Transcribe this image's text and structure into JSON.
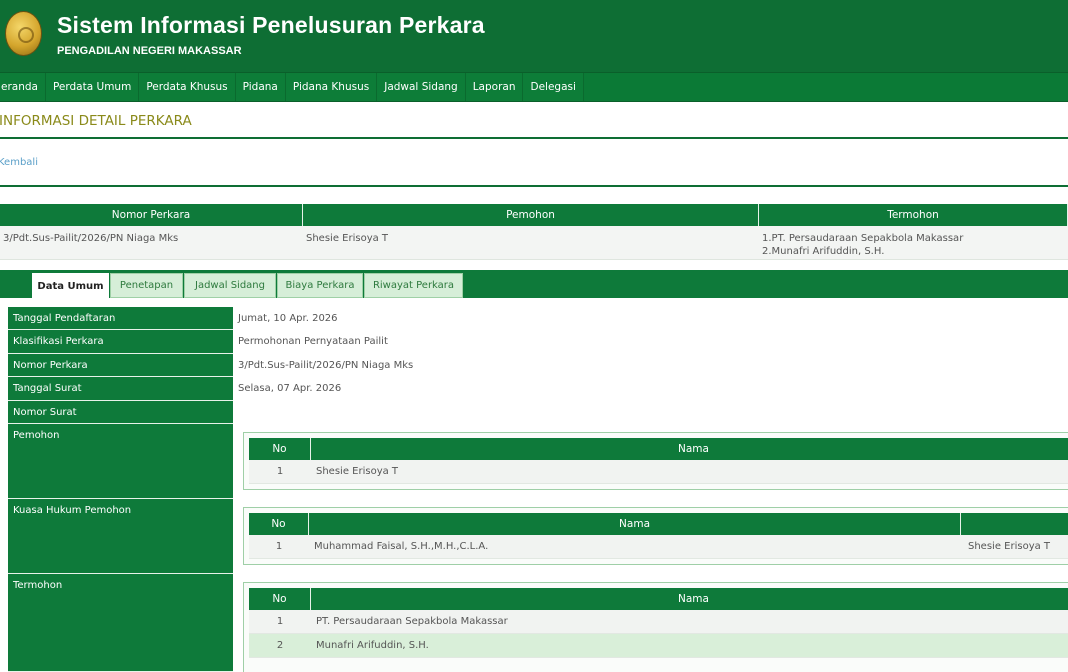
{
  "header": {
    "title": "Sistem Informasi Penelusuran Perkara",
    "subtitle": "PENGADILAN NEGERI MAKASSAR"
  },
  "nav": [
    "eranda",
    "Perdata Umum",
    "Perdata Khusus",
    "Pidana",
    "Pidana Khusus",
    "Jadwal Sidang",
    "Laporan",
    "Delegasi"
  ],
  "page": {
    "title": "INFORMASI DETAIL PERKARA",
    "back_label": "Kembali"
  },
  "summary": {
    "headers": [
      "Nomor Perkara",
      "Pemohon",
      "Termohon"
    ],
    "row": {
      "nomor": "3/Pdt.Sus-Pailit/2026/PN Niaga Mks",
      "pemohon": "Shesie Erisoya T",
      "termohon_1": "1.PT. Persaudaraan Sepakbola Makassar",
      "termohon_2": "2.Munafri Arifuddin, S.H."
    }
  },
  "tabs": [
    "Data Umum",
    "Penetapan",
    "Jadwal Sidang",
    "Biaya Perkara",
    "Riwayat Perkara"
  ],
  "detail": {
    "labels": {
      "tanggal_pendaftaran": "Tanggal Pendaftaran",
      "klasifikasi": "Klasifikasi Perkara",
      "nomor_perkara": "Nomor Perkara",
      "tanggal_surat": "Tanggal Surat",
      "nomor_surat": "Nomor Surat",
      "pemohon": "Pemohon",
      "kuasa": "Kuasa Hukum Pemohon",
      "termohon": "Termohon"
    },
    "values": {
      "tanggal_pendaftaran": "Jumat, 10 Apr. 2026",
      "klasifikasi": "Permohonan Pernyataan Pailit",
      "nomor_perkara": "3/Pdt.Sus-Pailit/2026/PN Niaga Mks",
      "tanggal_surat": "Selasa, 07 Apr. 2026",
      "nomor_surat": ""
    },
    "pemohon_table": {
      "headers": [
        "No",
        "Nama"
      ],
      "rows": [
        {
          "no": "1",
          "nama": "Shesie Erisoya T"
        }
      ]
    },
    "kuasa_table": {
      "headers": [
        "No",
        "Nama"
      ],
      "rows": [
        {
          "no": "1",
          "nama": "Muhammad Faisal, S.H.,M.H.,C.L.A.",
          "pihak": "Shesie Erisoya T"
        }
      ]
    },
    "termohon_table": {
      "headers": [
        "No",
        "Nama"
      ],
      "rows": [
        {
          "no": "1",
          "nama": "PT. Persaudaraan Sepakbola Makassar"
        },
        {
          "no": "2",
          "nama": "Munafri Arifuddin, S.H."
        }
      ]
    }
  },
  "colors": {
    "primary_green": "#0e6e34",
    "tab_light": "#d6eed8",
    "title_olive": "#8a8a1a",
    "link_blue": "#5a9fc8"
  }
}
